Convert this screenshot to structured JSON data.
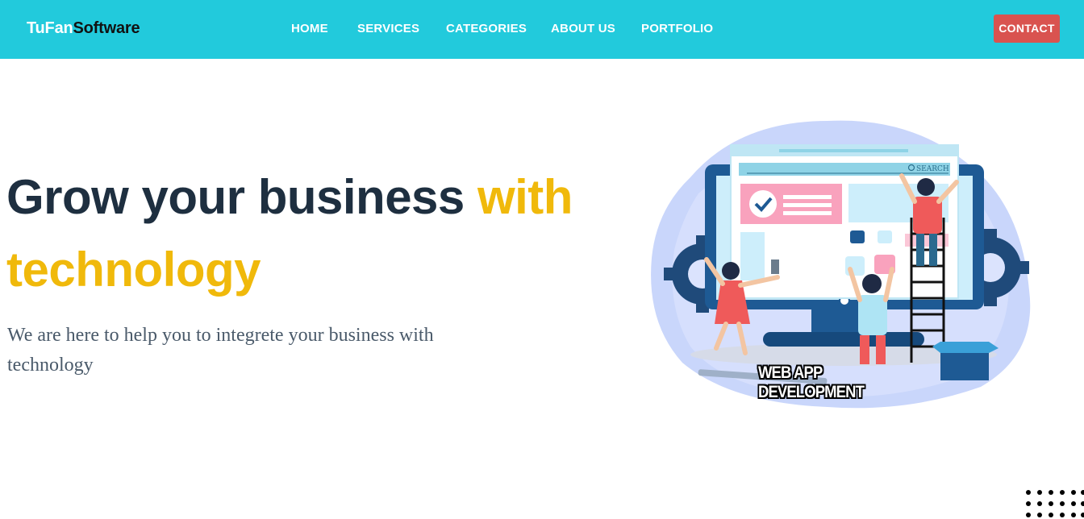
{
  "brand": {
    "part1": "TuFan",
    "part2": "Software"
  },
  "nav": {
    "items": [
      {
        "label": "HOME"
      },
      {
        "label": "SERVICES"
      },
      {
        "label": "CATEGORIES"
      },
      {
        "label": "ABOUT US"
      },
      {
        "label": "PORTFOLIO"
      }
    ],
    "contact_label": "CONTACT"
  },
  "hero": {
    "title_main": "Grow your business ",
    "title_highlight_1": "with",
    "title_highlight_2": "technology",
    "subtitle": "We are here to help you to integrete your business with technology"
  },
  "illustration": {
    "search_label": "SEARCH",
    "caption": "WEB APP DEVELOPMENT"
  },
  "colors": {
    "navbar": "#22cadc",
    "contact_button": "#d9534f",
    "heading": "#1e2f40",
    "highlight": "#f0b90b",
    "body_text": "#4a5a6a"
  }
}
